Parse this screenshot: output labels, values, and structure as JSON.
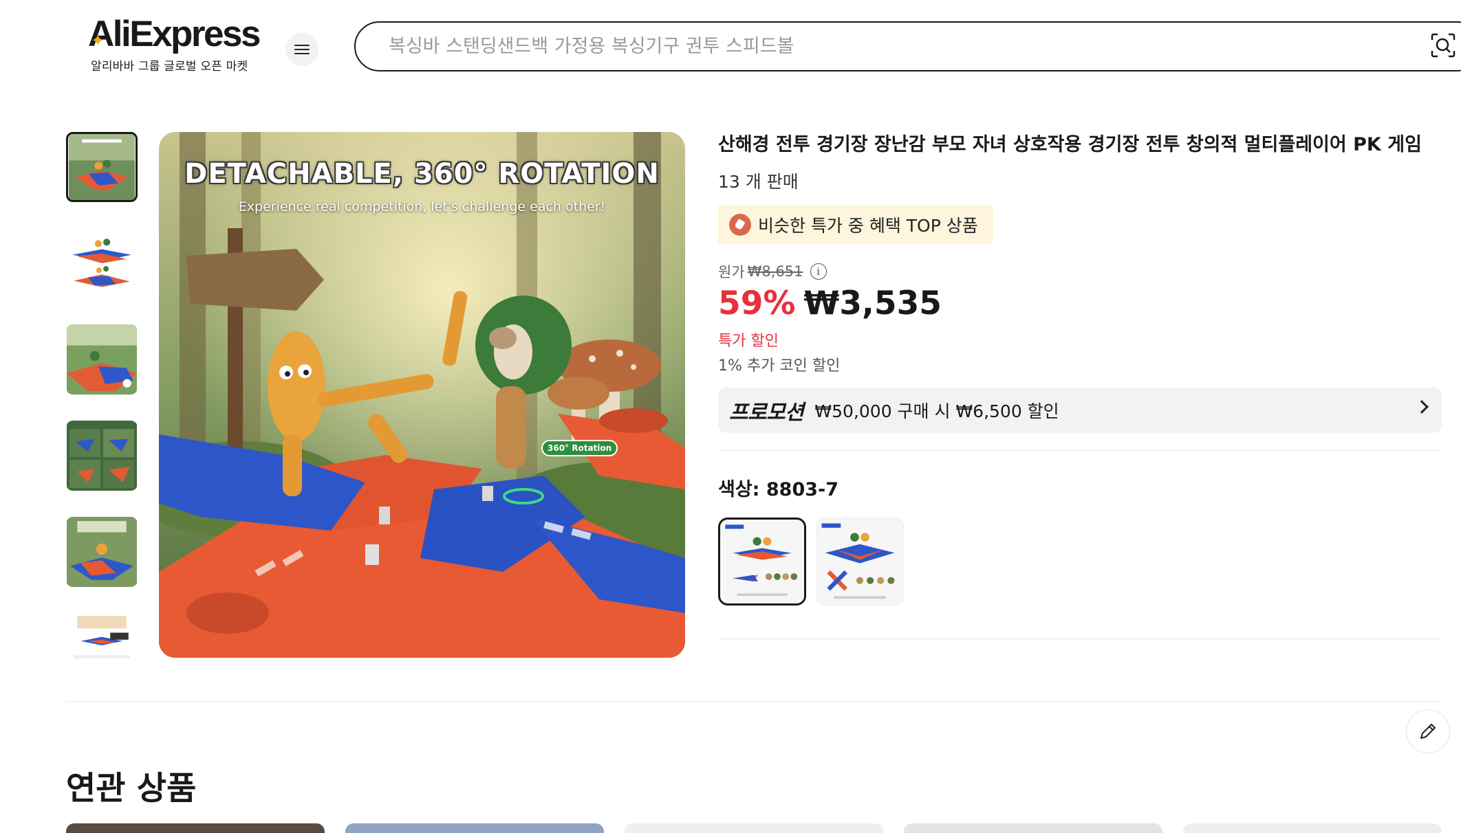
{
  "header": {
    "logo_text": "AliExpress",
    "logo_sub": "알리바바 그룹 글로벌 오픈 마켓",
    "search_placeholder": "복싱바 스탠딩샌드백 가정용 복싱기구 권투 스피드볼"
  },
  "gallery": {
    "image_title": "DETACHABLE, 360° ROTATION",
    "image_subtitle": "Experience real competition, let's challenge each other!",
    "rotation_badge": "360° Rotation",
    "thumbnail_count_visible": 6
  },
  "product": {
    "title": "산해경 전투 경기장 장난감 부모 자녀 상호작용 경기장 전투 창의적 멀티플레이어 PK 게임",
    "sold": "13 개 판매",
    "top_badge": "비슷한 특가 중 혜택 TOP 상품",
    "original_label": "원가",
    "original_price": "₩8,651",
    "discount": "59%",
    "price": "₩3,535",
    "special_discount": "특가 할인",
    "coin_discount": "1% 추가 코인 할인",
    "promo_label": "프로모션",
    "promo_text": "₩50,000 구매 시 ₩6,500 할인",
    "color_label": "색상: 8803-7"
  },
  "related": {
    "title": "연관 상품"
  },
  "colors": {
    "accent_red": "#e8303d",
    "badge_bg": "#fff4dc",
    "promo_bg": "#f2f2f2"
  }
}
